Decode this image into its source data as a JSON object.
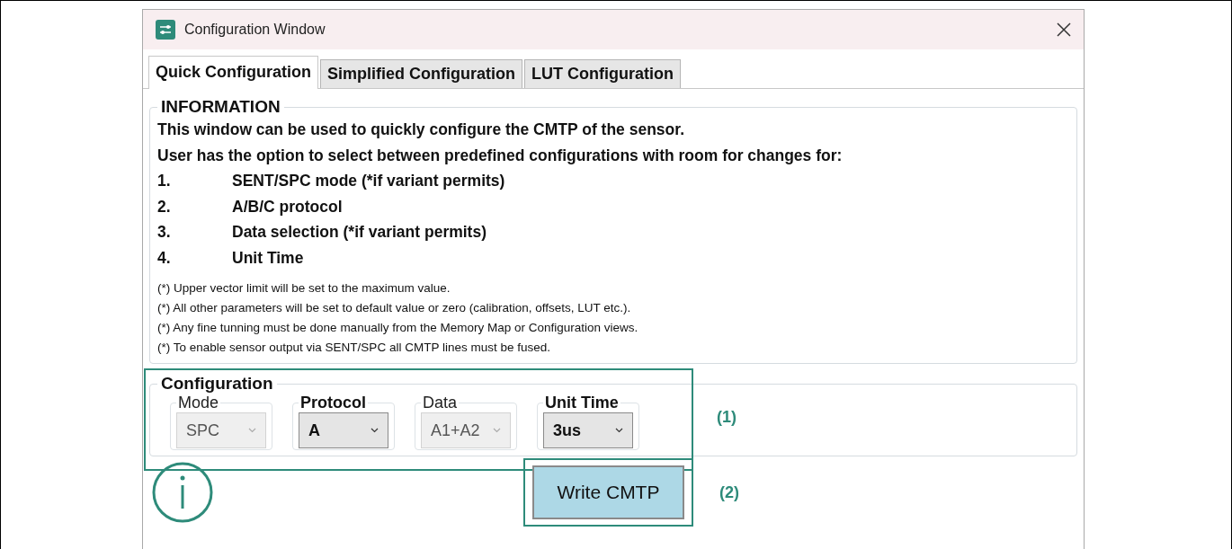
{
  "window": {
    "title": "Configuration Window"
  },
  "tabs": [
    {
      "label": "Quick Configuration",
      "selected": true
    },
    {
      "label": "Simplified Configuration",
      "selected": false
    },
    {
      "label": "LUT Configuration",
      "selected": false
    }
  ],
  "information": {
    "legend": "INFORMATION",
    "intro": [
      "This window can be used to quickly configure the CMTP of the sensor.",
      "User has the option to select between predefined configurations with room for changes for:"
    ],
    "items": [
      {
        "number": "1.",
        "text": "SENT/SPC mode (*if variant permits)"
      },
      {
        "number": "2.",
        "text": "A/B/C protocol"
      },
      {
        "number": "3.",
        "text": "Data selection (*if variant permits)"
      },
      {
        "number": "4.",
        "text": "Unit Time"
      }
    ],
    "notes": [
      "(*) Upper vector limit will be set to the maximum value.",
      "(*) All other parameters will be set to default value or zero (calibration, offsets, LUT etc.).",
      "(*) Any fine tunning must be done manually from the Memory Map or Configuration views.",
      "(*) To enable sensor output via SENT/SPC all CMTP lines must be fused."
    ]
  },
  "configuration": {
    "legend": "Configuration",
    "fields": [
      {
        "label": "Mode",
        "value": "SPC",
        "disabled": true
      },
      {
        "label": "Protocol",
        "value": "A",
        "disabled": false
      },
      {
        "label": "Data",
        "value": "A1+A2",
        "disabled": true
      },
      {
        "label": "Unit Time",
        "value": "3us",
        "disabled": false
      }
    ]
  },
  "write_button": "Write CMTP",
  "callouts": [
    {
      "label": "(1)"
    },
    {
      "label": "(2)"
    }
  ]
}
